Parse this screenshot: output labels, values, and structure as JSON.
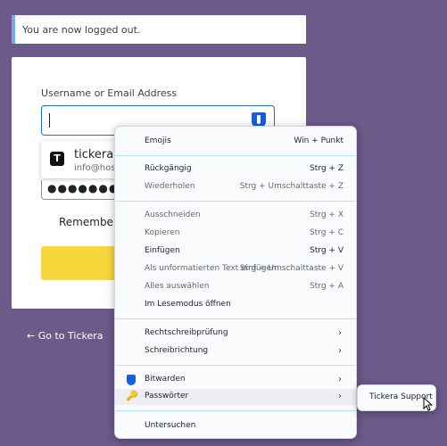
{
  "notice": {
    "text": "You are now logged out."
  },
  "form": {
    "username_label": "Username or Email Address",
    "autofill_title": "tickera.c",
    "autofill_sub": "info@hos",
    "autofill_logo": "T",
    "password_mask": "●●●●●●●●●",
    "remember_label": "Remember M"
  },
  "back_link": "← Go to Tickera",
  "context_menu": {
    "emojis": {
      "label": "Emojis",
      "shortcut": "Win + Punkt"
    },
    "undo": {
      "label": "Rückgängig",
      "shortcut": "Strg + Z"
    },
    "redo": {
      "label": "Wiederholen",
      "shortcut": "Strg + Umschalttaste + Z"
    },
    "cut": {
      "label": "Ausschneiden",
      "shortcut": "Strg + X"
    },
    "copy": {
      "label": "Kopieren",
      "shortcut": "Strg + C"
    },
    "paste": {
      "label": "Einfügen",
      "shortcut": "Strg + V"
    },
    "paste_plain": {
      "label": "Als unformatierten Text einfügen",
      "shortcut": "Strg + Umschalttaste + V"
    },
    "select_all": {
      "label": "Alles auswählen",
      "shortcut": "Strg + A"
    },
    "reading_mode": {
      "label": "Im Lesemodus öffnen"
    },
    "spellcheck": {
      "label": "Rechtschreibprüfung"
    },
    "writing_direction": {
      "label": "Schreibrichtung"
    },
    "bitwarden": {
      "label": "Bitwarden"
    },
    "passwords": {
      "label": "Passwörter"
    },
    "inspect": {
      "label": "Untersuchen"
    }
  },
  "submenu": {
    "item": "Tickera Support"
  },
  "colors": {
    "background": "#6c5a8b",
    "login_button": "#f7d63b",
    "bitwarden": "#175ddc",
    "notice_border": "#72aee6"
  }
}
